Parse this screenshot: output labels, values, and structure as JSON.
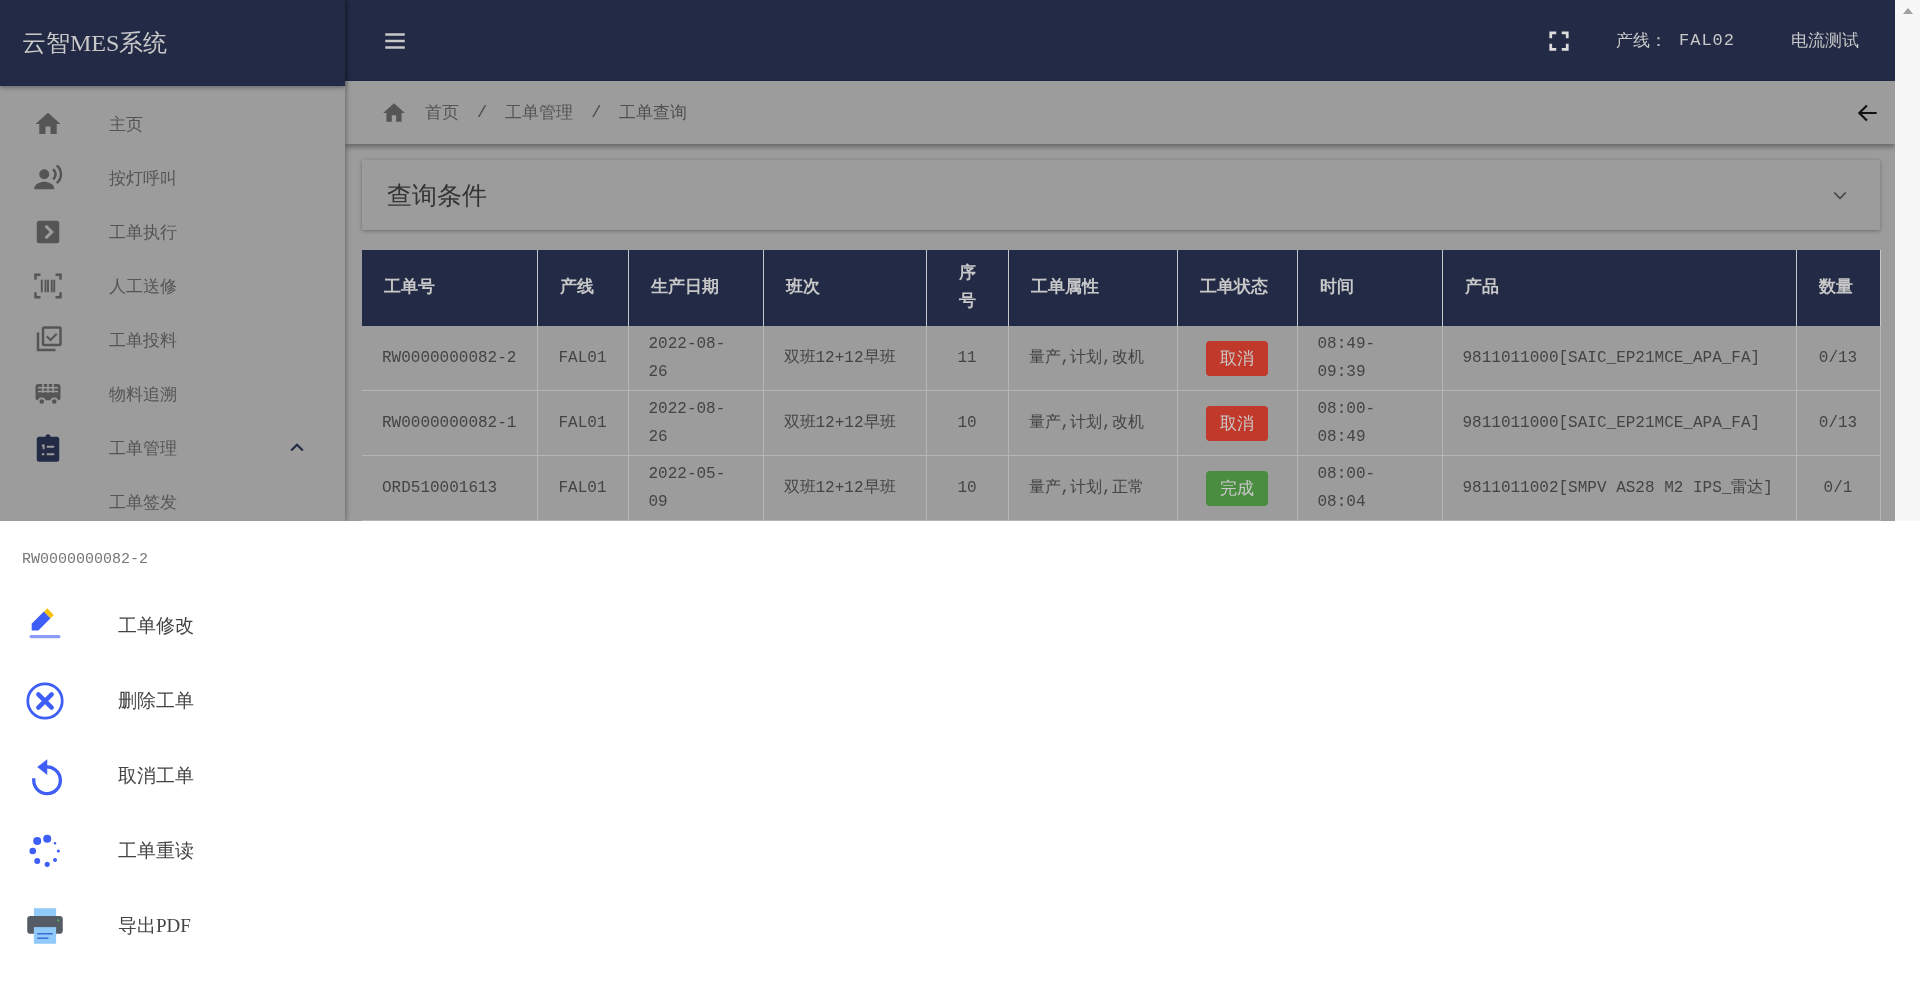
{
  "app_title": "云智MES系统",
  "header": {
    "line_label": "产线：",
    "line_value": "FAL02",
    "user": "电流测试"
  },
  "sidebar": {
    "items": [
      {
        "label": "主页",
        "selected": false
      },
      {
        "label": "按灯呼叫",
        "selected": false
      },
      {
        "label": "工单执行",
        "selected": false
      },
      {
        "label": "人工送修",
        "selected": false
      },
      {
        "label": "工单投料",
        "selected": false
      },
      {
        "label": "物料追溯",
        "selected": false
      },
      {
        "label": "工单管理",
        "selected": true,
        "expanded": true,
        "children": [
          {
            "label": "工单签发"
          }
        ]
      }
    ]
  },
  "breadcrumb": [
    {
      "kind": "link",
      "label": "首页"
    },
    {
      "kind": "separator",
      "label": "/"
    },
    {
      "kind": "link",
      "label": "工单管理"
    },
    {
      "kind": "separator",
      "label": "/"
    },
    {
      "kind": "current",
      "label": "工单查询"
    }
  ],
  "query_panel": {
    "title": "查询条件",
    "expanded": false
  },
  "table": {
    "columns": [
      "工单号",
      "产线",
      "生产日期",
      "班次",
      "序号",
      "工单属性",
      "工单状态",
      "时间",
      "产品",
      "数量"
    ],
    "rows": [
      {
        "order_no": "RW0000000082-2",
        "line": "FAL01",
        "date": "2022-08-26",
        "shift": "双班12+12早班",
        "seq": "11",
        "attributes": "量产,计划,改机",
        "status": {
          "label": "取消",
          "color": "#c0392b"
        },
        "time": "08:49-09:39",
        "product": "9811011000[SAIC_EP21MCE_APA_FA]",
        "qty": "0/13"
      },
      {
        "order_no": "RW0000000082-1",
        "line": "FAL01",
        "date": "2022-08-26",
        "shift": "双班12+12早班",
        "seq": "10",
        "attributes": "量产,计划,改机",
        "status": {
          "label": "取消",
          "color": "#c0392b"
        },
        "time": "08:00-08:49",
        "product": "9811011000[SAIC_EP21MCE_APA_FA]",
        "qty": "0/13"
      },
      {
        "order_no": "ORD510001613",
        "line": "FAL01",
        "date": "2022-05-09",
        "shift": "双班12+12早班",
        "seq": "10",
        "attributes": "量产,计划,正常",
        "status": {
          "label": "完成",
          "color": "#4a8c40"
        },
        "time": "08:00-08:04",
        "product": "9811011002[SMPV AS28 M2 IPS_雷达]",
        "qty": "0/1"
      }
    ]
  },
  "action_sheet": {
    "title": "RW0000000082-2",
    "actions": [
      {
        "label": "工单修改"
      },
      {
        "label": "删除工单"
      },
      {
        "label": "取消工单"
      },
      {
        "label": "工单重读"
      },
      {
        "label": "导出PDF"
      }
    ]
  }
}
